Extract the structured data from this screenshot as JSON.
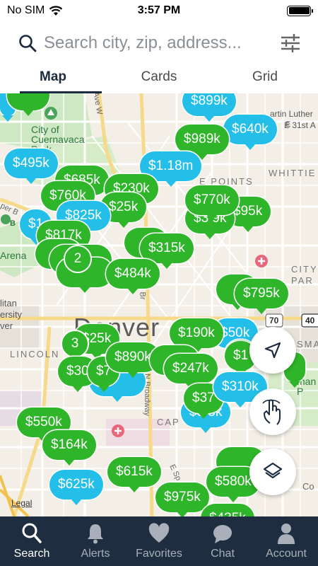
{
  "status": {
    "carrier": "No SIM",
    "time": "3:57 PM"
  },
  "search": {
    "placeholder": "Search city, zip, address..."
  },
  "tabs": [
    {
      "label": "Map",
      "active": true
    },
    {
      "label": "Cards",
      "active": false
    },
    {
      "label": "Grid",
      "active": false
    }
  ],
  "map": {
    "labels": {
      "city_of_cuernavaca_park": "City of Cuernavaca Park",
      "martin_luther": "artin Luther",
      "e31st": "E 31st A",
      "whittier": "WHITTIE",
      "five_points": "E POINTS",
      "city": "CITY",
      "park": "PAR",
      "arena": "Arena",
      "metropolitan": "litan",
      "university": "ersity",
      "ver": "ver",
      "lincoln": "LINCOLN",
      "capitol": "CAP",
      "smart": "SMA",
      "sherman_park": "man P",
      "denver": "Denver",
      "ave_w": "Ave W",
      "e_street": "E",
      "n_broadway": "N Broadway",
      "e_sp": "E Sp",
      "broadway": "Br",
      "pepper": "per B",
      "b_label": "B",
      "to_label": "70",
      "i40": "40",
      "co": "Co"
    },
    "pins_green": [
      "$989k",
      "$760k",
      "$770k",
      "$95k",
      "$25k",
      "$817k",
      "$315k",
      "$484k",
      "$795k",
      "$190k",
      "$25k",
      "$890k",
      "$247k",
      "$550k",
      "$164k",
      "$615k",
      "$975k",
      "$580k",
      "$435k",
      "$30",
      "$7",
      "$37",
      "$1",
      "$1",
      "$8",
      "$685k",
      "$230k",
      "$3 9k"
    ],
    "pins_blue": [
      "$899k",
      "$640k",
      "$495k",
      "$1.18m",
      "$825k",
      "$1",
      "$310k",
      "$625k",
      "$50k",
      "$5 5k"
    ],
    "clusters": [
      "2",
      "3"
    ],
    "legal": "Legal"
  },
  "fabs": {
    "locate": "location-arrow-icon",
    "draw": "draw-hand-icon",
    "layers": "layers-icon"
  },
  "nav": [
    {
      "label": "Search",
      "icon": "search-icon",
      "active": true
    },
    {
      "label": "Alerts",
      "icon": "bell-icon",
      "active": false
    },
    {
      "label": "Favorites",
      "icon": "heart-icon",
      "active": false
    },
    {
      "label": "Chat",
      "icon": "chat-icon",
      "active": false
    },
    {
      "label": "Account",
      "icon": "person-icon",
      "active": false
    }
  ],
  "colors": {
    "green_pin": "#2fb52a",
    "blue_pin": "#23bfe8",
    "nav_bg": "#1e2d40",
    "active_tab": "#1b2b3f"
  }
}
